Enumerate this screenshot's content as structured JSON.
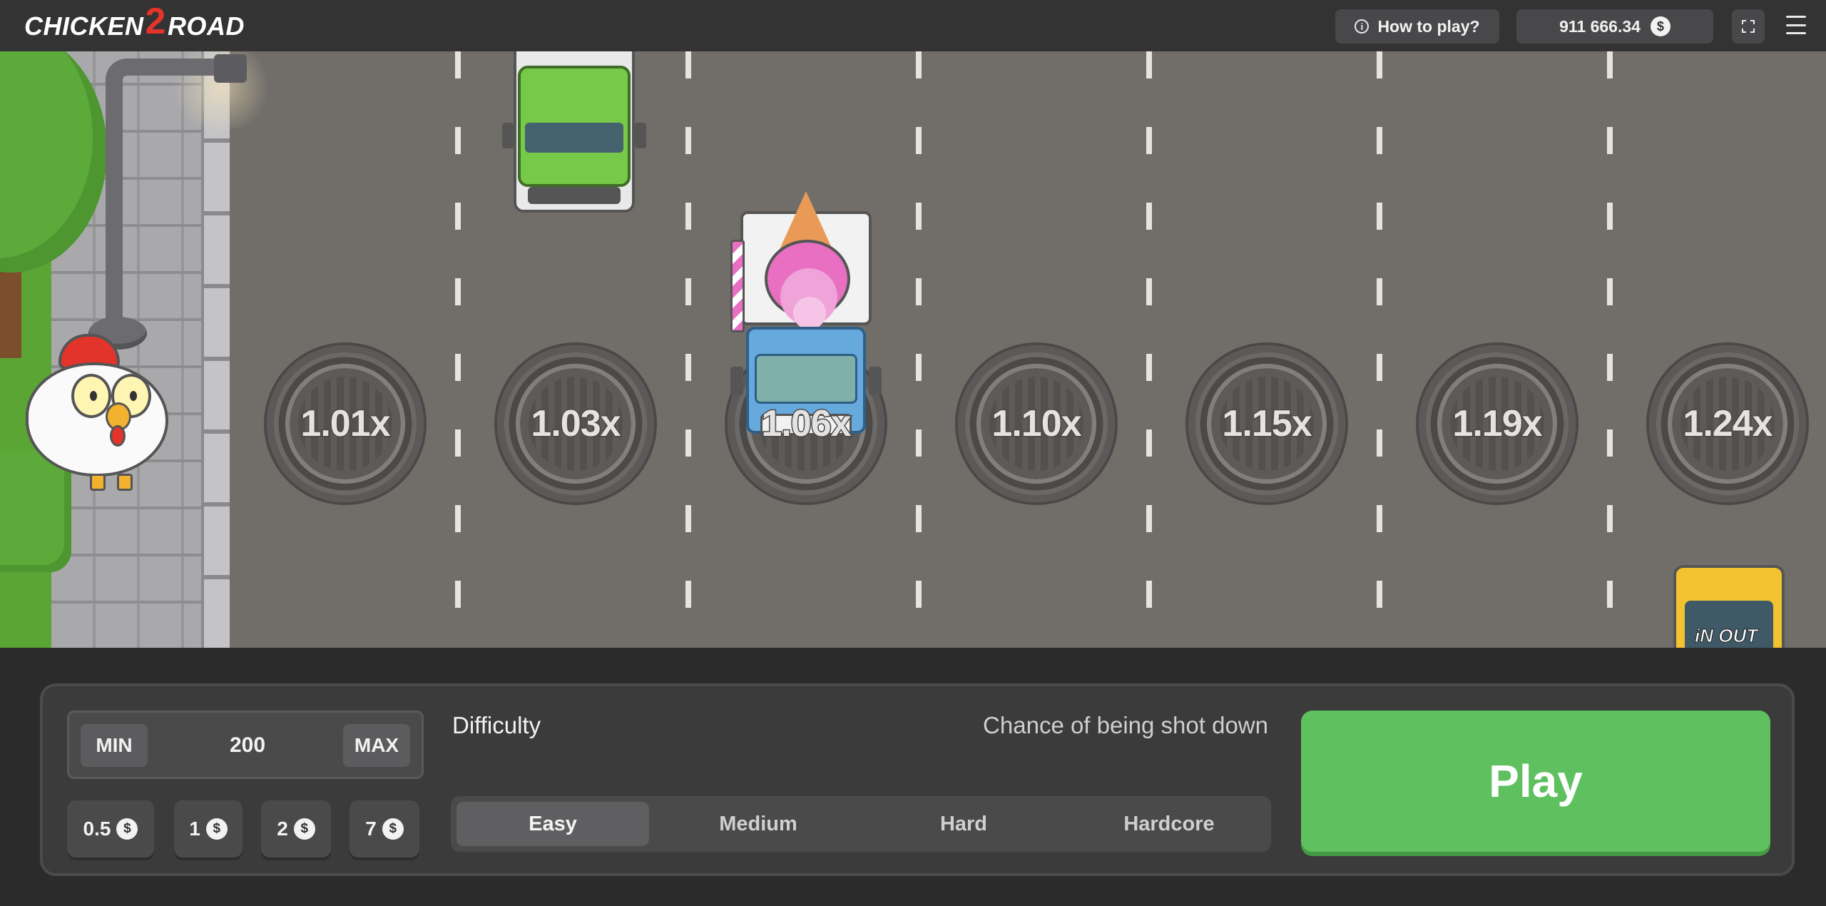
{
  "header": {
    "logo_text_left": "CHICKEN",
    "logo_number": "2",
    "logo_text_right": "ROAD",
    "how_to_play_label": "How to play?",
    "info_icon": "i",
    "balance": "911 666.34",
    "currency_symbol": "$"
  },
  "game": {
    "multipliers": [
      "1.01x",
      "1.03x",
      "1.06x",
      "1.10x",
      "1.15x",
      "1.19x",
      "1.24x"
    ],
    "bus_brand": "iN OUT"
  },
  "bet": {
    "min_label": "MIN",
    "max_label": "MAX",
    "amount": "200",
    "quick_bets": [
      "0.5",
      "1",
      "2",
      "7"
    ]
  },
  "difficulty": {
    "label": "Difficulty",
    "chance_label": "Chance of being shot down",
    "options": [
      "Easy",
      "Medium",
      "Hard",
      "Hardcore"
    ],
    "selected": "Easy"
  },
  "play_label": "Play",
  "colors": {
    "accent_green": "#5ec05e",
    "road": "#716e6a",
    "panel": "#3b3b3c"
  }
}
